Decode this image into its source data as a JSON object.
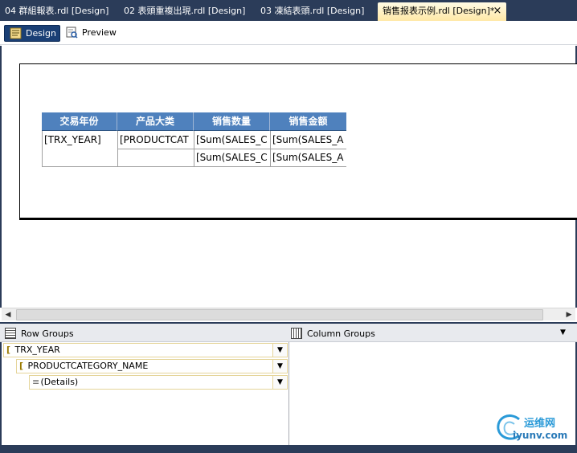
{
  "tabs": [
    {
      "label": "04 群組報表.rdl [Design]"
    },
    {
      "label": "02 表頭重複出現.rdl [Design]"
    },
    {
      "label": "03 凍結表頭.rdl [Design]"
    },
    {
      "label": "销售报表示例.rdl [Design]*",
      "active": true
    }
  ],
  "tab_close": "×",
  "view": {
    "design_label": "Design",
    "preview_label": "Preview"
  },
  "tablix": {
    "headers": [
      "交易年份",
      "产品大类",
      "销售数量",
      "销售金额"
    ],
    "row1": [
      "[TRX_YEAR]",
      "[PRODUCTCAT",
      "[Sum(SALES_C",
      "[Sum(SALES_A"
    ],
    "row2": [
      "",
      "",
      "[Sum(SALES_C",
      "[Sum(SALES_A"
    ]
  },
  "scroll": {
    "left_arrow": "◀",
    "right_arrow": "▶"
  },
  "row_groups": {
    "title": "Row Groups",
    "items": [
      {
        "label": "TRX_YEAR",
        "bracket": "["
      },
      {
        "label": "PRODUCTCATEGORY_NAME",
        "bracket": "["
      },
      {
        "label": "(Details)",
        "bracket": "≡"
      }
    ]
  },
  "column_groups": {
    "title": "Column Groups"
  },
  "dropdown_glyph": "▼",
  "watermark": {
    "line1": "运维网",
    "line2": "iyunv.com"
  },
  "colors": {
    "chrome": "#2b3c59",
    "header_fill": "#4f81bd",
    "active_tab": "#ffe8a6"
  }
}
